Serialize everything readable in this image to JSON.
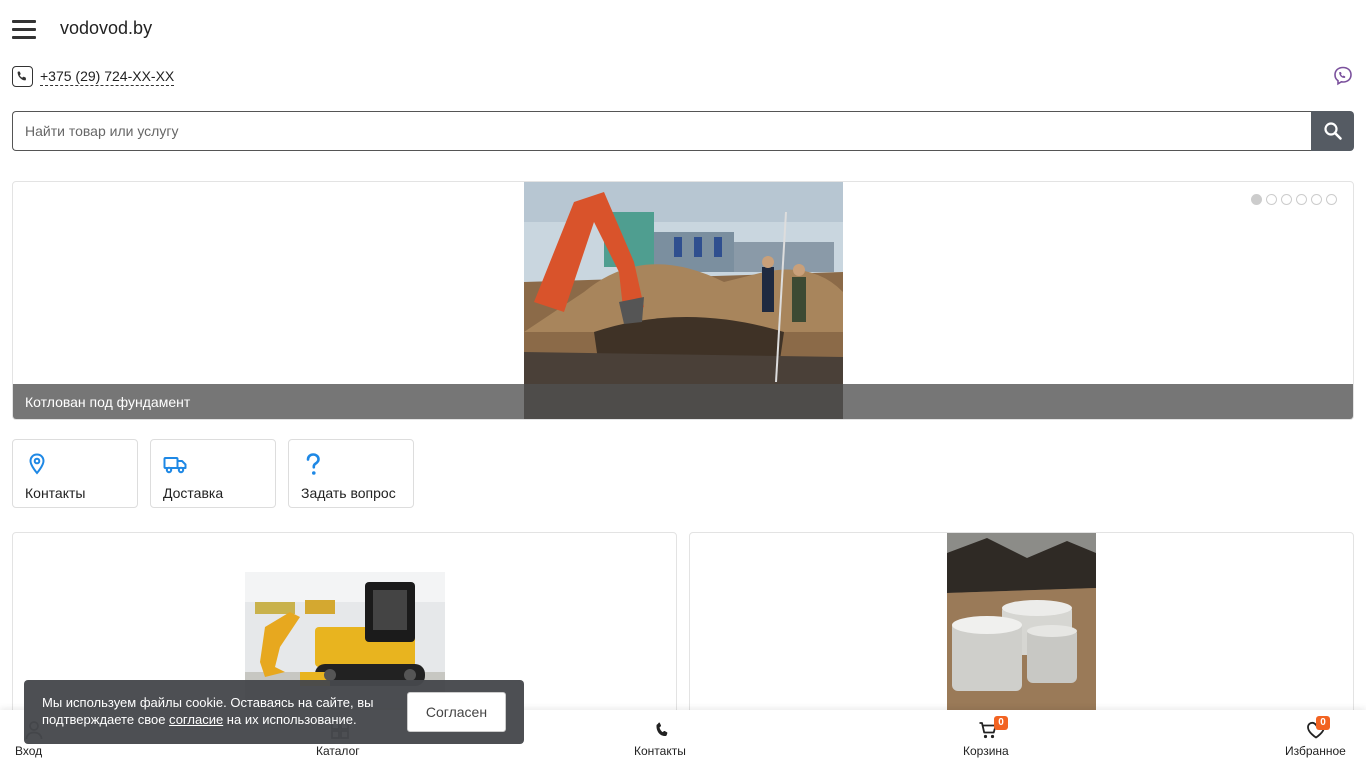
{
  "header": {
    "logo": "vodovod.by"
  },
  "contact": {
    "phone": "+375 (29) 724-XX-XX"
  },
  "search": {
    "placeholder": "Найти товар или услугу"
  },
  "slider": {
    "caption": "Котлован под фундамент",
    "dots_total": 6,
    "active_dot": 1
  },
  "quick_links": [
    {
      "label": "Контакты",
      "icon": "map-pin-icon"
    },
    {
      "label": "Доставка",
      "icon": "truck-icon"
    },
    {
      "label": "Задать вопрос",
      "icon": "question-icon"
    }
  ],
  "bottom_nav": {
    "login": "Вход",
    "catalog": "Каталог",
    "contacts": "Контакты",
    "cart": "Корзина",
    "cart_count": "0",
    "favorites": "Избранное",
    "favorites_count": "0"
  },
  "cookie": {
    "text_before": "Мы используем файлы cookie. Оставаясь на сайте, вы подтверждаете свое ",
    "link": "согласие",
    "text_after": " на их использование.",
    "button": "Согласен"
  },
  "colors": {
    "accent_blue": "#1e88e5",
    "badge_orange": "#f26322",
    "viber_purple": "#7b519d",
    "search_button": "#555b63"
  }
}
